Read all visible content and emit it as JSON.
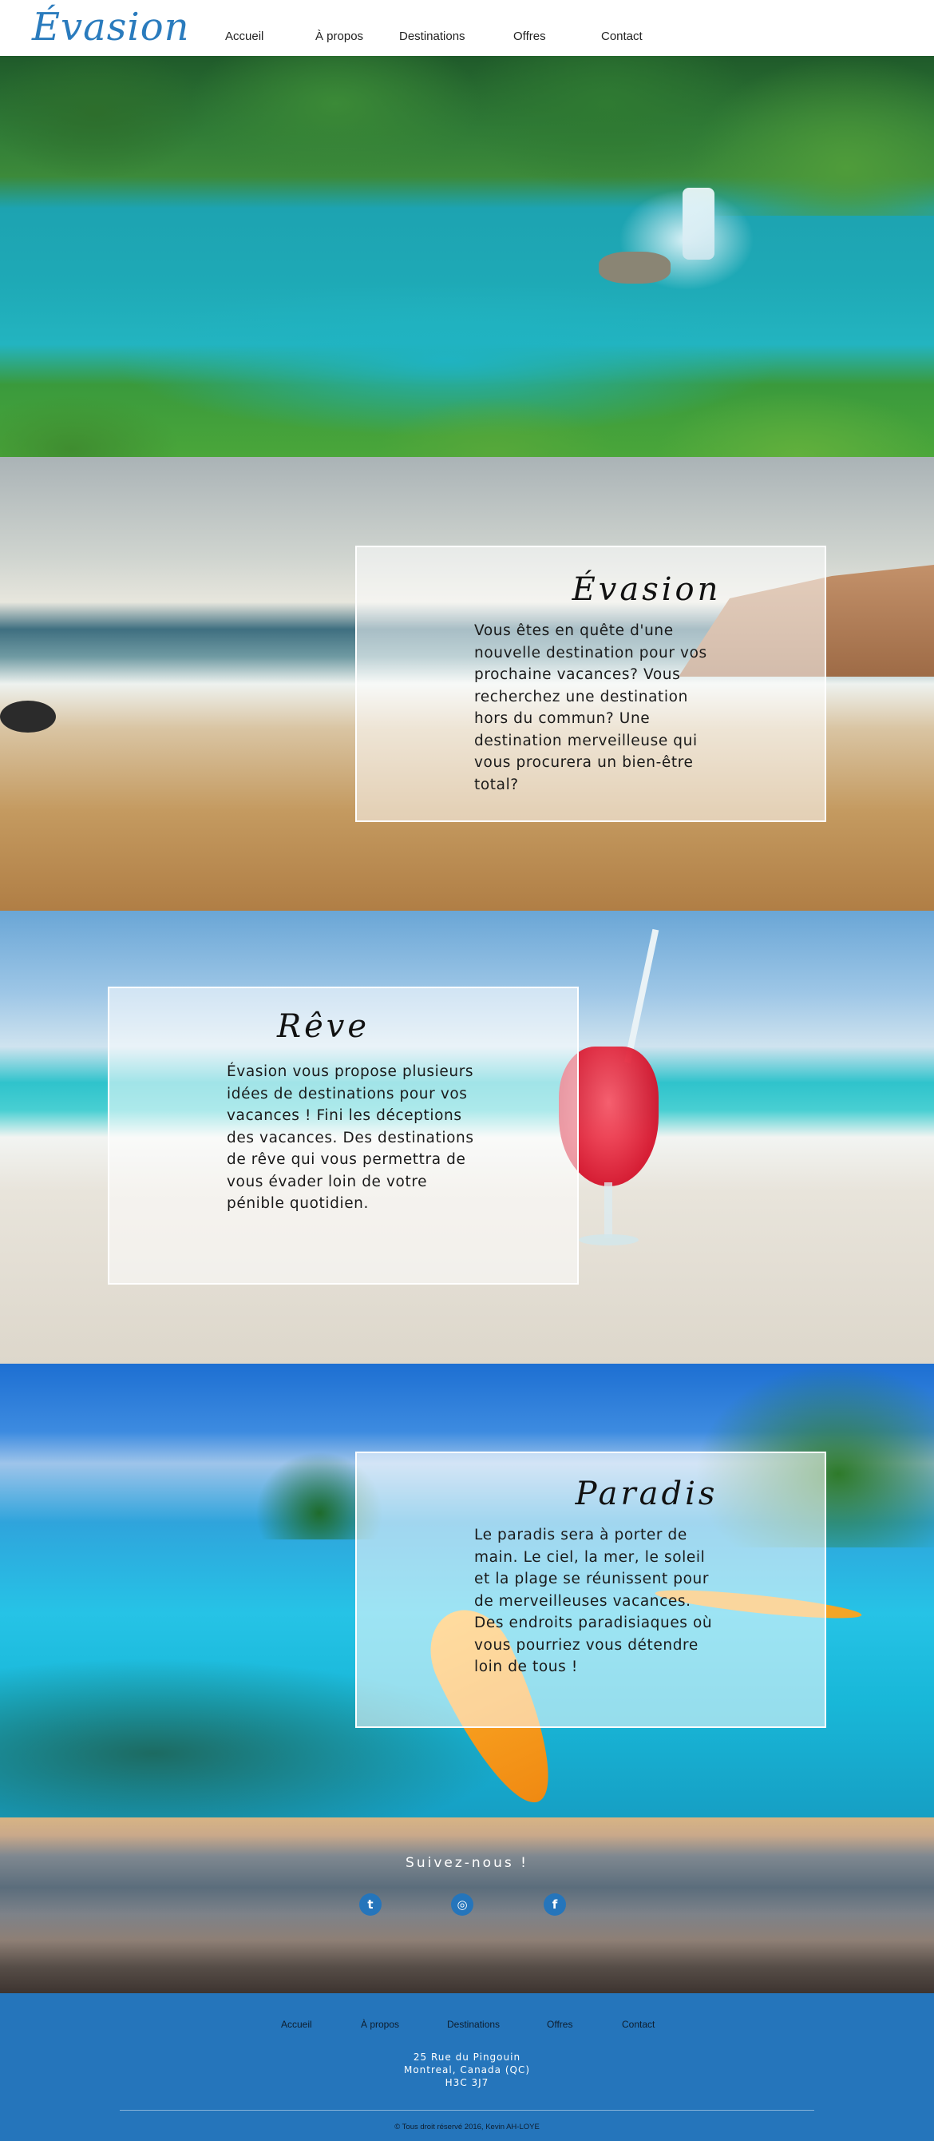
{
  "header": {
    "logo": "Évasion",
    "nav": [
      "Accueil",
      "À propos",
      "Destinations",
      "Offres",
      "Contact"
    ]
  },
  "sections": {
    "evasion": {
      "title": "Évasion",
      "text": "Vous êtes en quête d'une nouvelle destination pour vos prochaine vacances? Vous recherchez une destination hors du commun? Une destination merveilleuse qui vous procurera un bien-être total?"
    },
    "reve": {
      "title": "Rêve",
      "text": "Évasion vous propose plusieurs idées de destinations pour vos vacances ! Fini les déceptions des vacances. Des destinations de rêve qui vous permettra de vous évader loin de votre pénible quotidien."
    },
    "paradis": {
      "title": "Paradis",
      "text": "Le paradis sera à porter de main. Le ciel, la mer, le soleil et la plage se réunissent pour de merveilleuses vacances. Des endroits paradisiaques où vous pourriez vous détendre loin de tous !"
    }
  },
  "social": {
    "title": "Suivez-nous !",
    "icons": [
      {
        "name": "twitter-icon",
        "glyph": "t"
      },
      {
        "name": "instagram-icon",
        "glyph": "◎"
      },
      {
        "name": "facebook-icon",
        "glyph": "f"
      }
    ]
  },
  "footer": {
    "nav": [
      "Accueil",
      "À propos",
      "Destinations",
      "Offres",
      "Contact"
    ],
    "address": {
      "line1": "25 Rue du Pingouin",
      "line2": "Montreal, Canada (QC)",
      "line3": "H3C 3J7"
    },
    "copyright": "© Tous droit réservé 2016, Kevin AH-LOYE"
  },
  "colors": {
    "brand_blue": "#2575bb",
    "logo_blue": "#2a7bbd"
  }
}
